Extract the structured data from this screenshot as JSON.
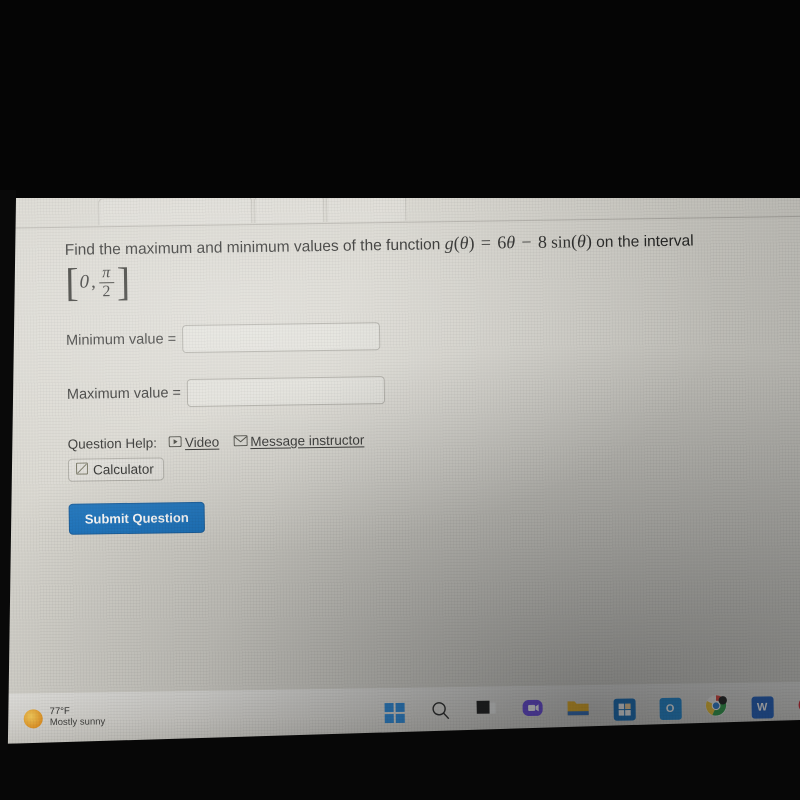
{
  "question": {
    "prompt_prefix": "Find the maximum and minimum values of the function",
    "function_name": "g",
    "function_arg": "θ",
    "equals": "=",
    "term1_coeff": "6",
    "term1_var": "θ",
    "minus": "−",
    "term2_coeff": "8",
    "term2_fn": "sin",
    "term2_arg": "θ",
    "prompt_suffix": "on the interval",
    "interval_lower": "0",
    "interval_comma": ",",
    "interval_upper_num": "π",
    "interval_upper_den": "2",
    "bracket_open": "[",
    "bracket_close": "]"
  },
  "answers": [
    {
      "label": "Minimum value =",
      "value": "",
      "placeholder": ""
    },
    {
      "label": "Maximum value =",
      "value": "",
      "placeholder": ""
    }
  ],
  "help": {
    "title": "Question Help:",
    "video_label": "Video",
    "message_label": "Message instructor",
    "calculator_label": "Calculator"
  },
  "submit": {
    "label": "Submit Question"
  },
  "taskbar": {
    "weather": {
      "temperature": "77°F",
      "condition": "Mostly sunny",
      "icon": "sun-icon"
    },
    "items": [
      {
        "name": "start-button",
        "icon": "windows-logo-icon",
        "label": ""
      },
      {
        "name": "search-button",
        "icon": "search-icon",
        "label": ""
      },
      {
        "name": "task-view-button",
        "icon": "task-view-icon",
        "label": ""
      },
      {
        "name": "chat-button",
        "icon": "chat-bubble-icon",
        "label": ""
      },
      {
        "name": "file-explorer-button",
        "icon": "folder-icon",
        "label": ""
      },
      {
        "name": "microsoft-store-button",
        "icon": "store-icon",
        "label": ""
      },
      {
        "name": "outlook-button",
        "icon": "outlook-icon",
        "label": "O"
      },
      {
        "name": "chrome-button",
        "icon": "chrome-icon",
        "label": ""
      },
      {
        "name": "word-button",
        "icon": "word-icon",
        "label": "W"
      },
      {
        "name": "opera-button",
        "icon": "opera-icon",
        "label": ""
      }
    ]
  },
  "colors": {
    "accent_blue": "#1470bd",
    "screen_bg": "#d8d6ce",
    "taskbar_bg": "#e4e2dd",
    "text": "#1f1f1d"
  }
}
